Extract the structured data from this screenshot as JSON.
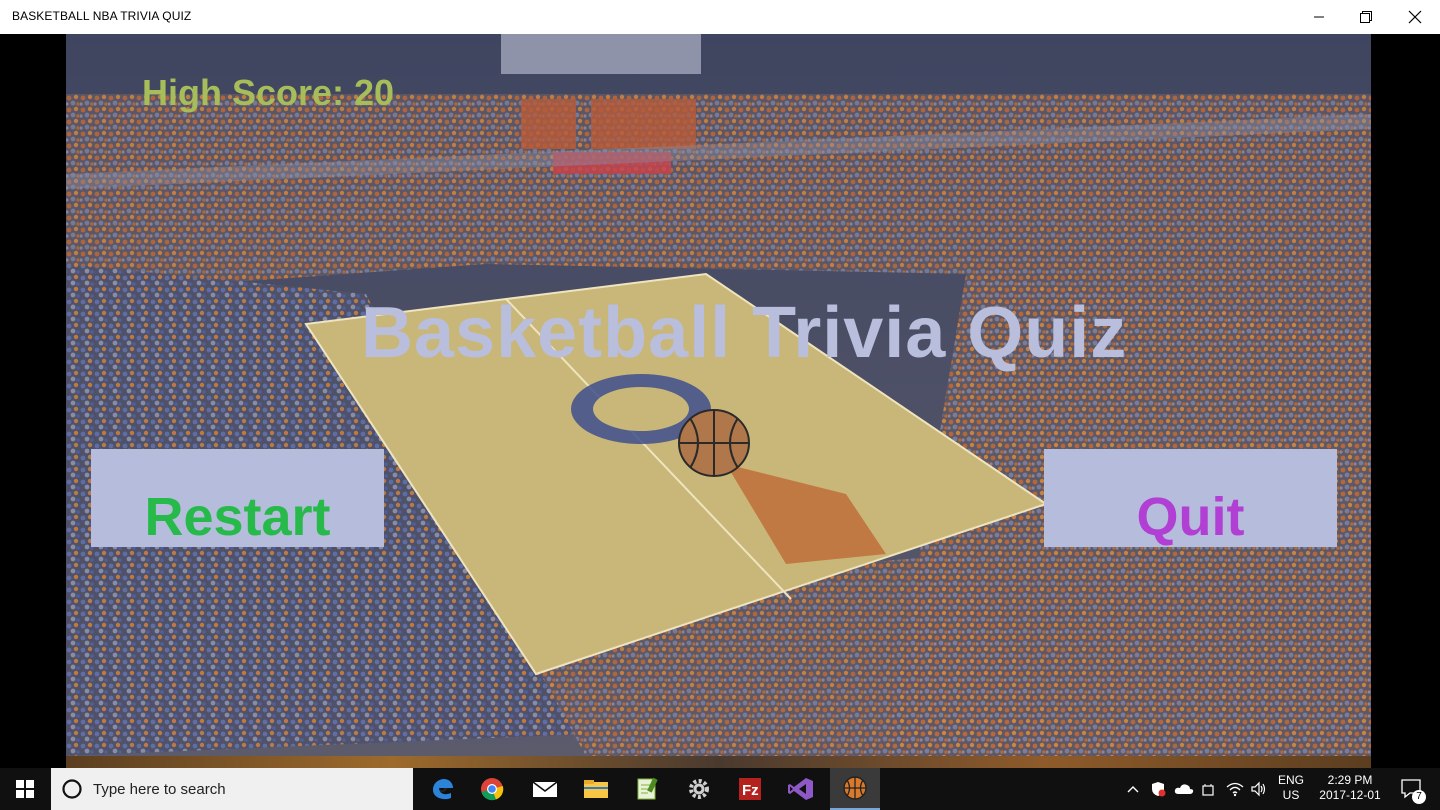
{
  "window": {
    "title": "BASKETBALL NBA TRIVIA QUIZ",
    "controls": [
      "minimize",
      "restore",
      "close"
    ]
  },
  "game": {
    "high_score_label": "High Score: 20",
    "title": "Basketball Trivia Quiz",
    "restart_label": "Restart",
    "quit_label": "Quit",
    "colors": {
      "high_score": "#a6bd5a",
      "title": "#b8bedb",
      "button_bg": "#b6bcdc",
      "restart_text": "#27ba4a",
      "quit_text": "#b13fd3"
    }
  },
  "taskbar": {
    "search_placeholder": "Type here to search",
    "pinned_apps": [
      "edge-icon",
      "chrome-icon",
      "mail-icon",
      "file-explorer-icon",
      "notepad-icon",
      "settings-icon",
      "filezilla-icon",
      "visual-studio-icon",
      "basketball-app-icon"
    ],
    "language_line1": "ENG",
    "language_line2": "US",
    "time": "2:29 PM",
    "date": "2017-12-01",
    "notification_count": "7"
  }
}
